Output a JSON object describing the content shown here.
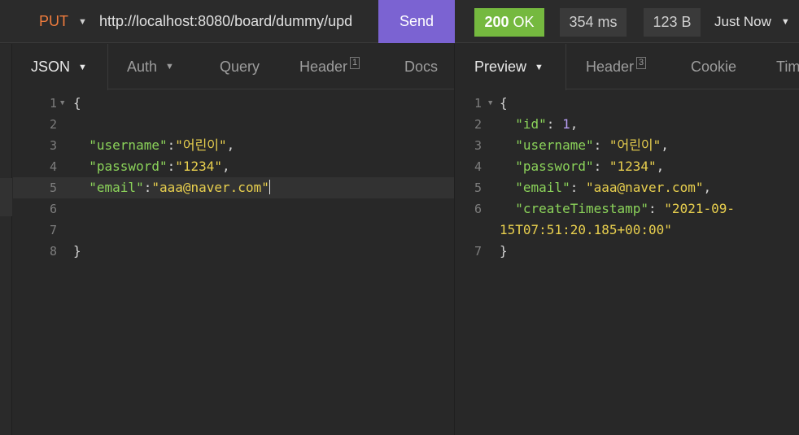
{
  "request": {
    "method": "PUT",
    "url": "http://localhost:8080/board/dummy/upd",
    "send_label": "Send"
  },
  "response": {
    "status_code": "200",
    "status_text": "OK",
    "time": "354 ms",
    "size": "123 B",
    "when": "Just Now"
  },
  "request_tabs": [
    {
      "label": "JSON"
    },
    {
      "label": "Auth"
    },
    {
      "label": "Query"
    },
    {
      "label": "Header",
      "badge": "1"
    },
    {
      "label": "Docs"
    }
  ],
  "response_tabs": [
    {
      "label": "Preview"
    },
    {
      "label": "Header",
      "badge": "3"
    },
    {
      "label": "Cookie"
    },
    {
      "label": "Tim"
    }
  ],
  "request_body": {
    "line_numbers": [
      "1",
      "2",
      "3",
      "4",
      "5",
      "6",
      "7",
      "8"
    ],
    "open_brace": "{",
    "close_brace": "}",
    "username_key": "\"username\"",
    "username_value": "\"어린이\"",
    "password_key": "\"password\"",
    "password_value": "\"1234\"",
    "email_key": "\"email\"",
    "email_value": "\"aaa@naver.com\""
  },
  "response_body": {
    "line_numbers": [
      "1",
      "2",
      "3",
      "4",
      "5",
      "6",
      "7"
    ],
    "open_brace": "{",
    "close_brace": "}",
    "id_key": "\"id\"",
    "id_value": "1",
    "username_key": "\"username\"",
    "username_value": "\"어린이\"",
    "password_key": "\"password\"",
    "password_value": "\"1234\"",
    "email_key": "\"email\"",
    "email_value": "\"aaa@naver.com\"",
    "timestamp_key": "\"createTimestamp\"",
    "timestamp_value_part1": "\"2021-09-",
    "timestamp_value_part2": "15T07:51:20.185+00:00\""
  },
  "colors": {
    "method": "#f07c3d",
    "send": "#7b63d2",
    "status_ok": "#75b93f",
    "json_key": "#8bd35a",
    "json_string": "#e8cf4e",
    "json_number": "#b79ef4"
  }
}
